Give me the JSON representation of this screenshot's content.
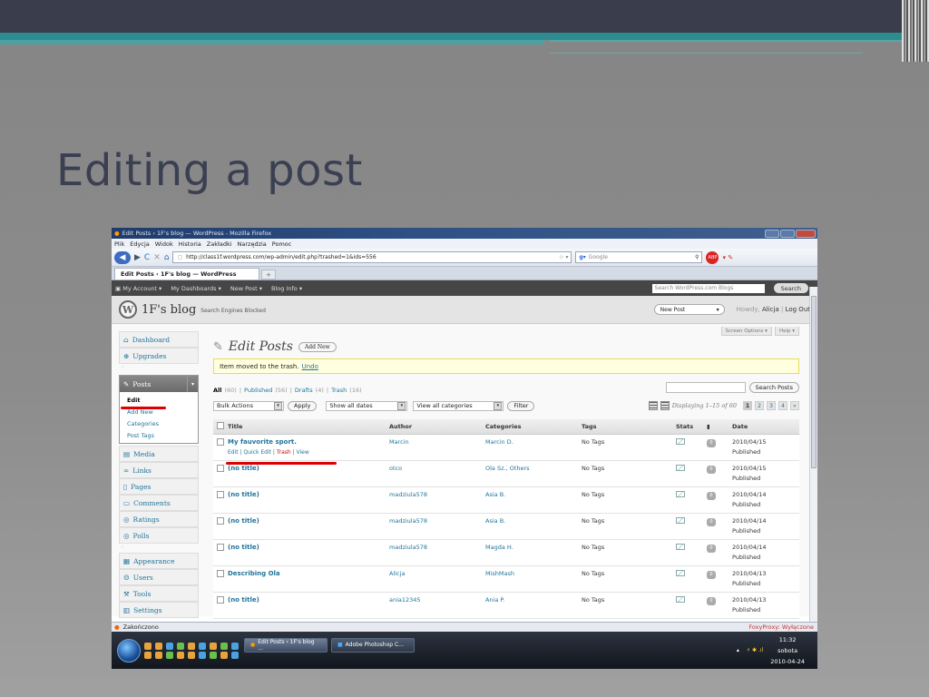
{
  "slide": {
    "title": "Editing a post"
  },
  "firefox": {
    "window_title": "Edit Posts ‹ 1F's blog — WordPress - Mozilla Firefox",
    "menu": [
      "Plik",
      "Edycja",
      "Widok",
      "Historia",
      "Zakładki",
      "Narzędzia",
      "Pomoc"
    ],
    "url": "http://class1f.wordpress.com/wp-admin/edit.php?trashed=1&ids=556",
    "search_placeholder": "Google",
    "tab_label": "Edit Posts ‹ 1F's blog — WordPress",
    "status": "Zakończono",
    "foxyproxy": "FoxyProxy: Wyłączone"
  },
  "adminbar": {
    "items": [
      "My Account ▾",
      "My Dashboards ▾",
      "New Post ▾",
      "Blog Info ▾"
    ],
    "search_placeholder": "Search WordPress.com Blogs",
    "search_button": "Search"
  },
  "header": {
    "blog_name": "1F's blog",
    "subtitle": "Search Engines Blocked",
    "new_post": "New Post",
    "howdy": "Howdy,",
    "user": "Alicja",
    "logout": "Log Out"
  },
  "sidebar": {
    "top": [
      "Dashboard",
      "Upgrades"
    ],
    "posts": "Posts",
    "posts_sub": [
      "Edit",
      "Add New",
      "Categories",
      "Post Tags"
    ],
    "mid": [
      "Media",
      "Links",
      "Pages",
      "Comments",
      "Ratings",
      "Polls"
    ],
    "bottom": [
      "Appearance",
      "Users",
      "Tools",
      "Settings"
    ]
  },
  "main": {
    "screen_options": "Screen Options ▾",
    "help": "Help ▾",
    "page_title": "Edit Posts",
    "add_new": "Add New",
    "notice": "Item moved to the trash.",
    "undo": "Undo",
    "filters": {
      "all": "All",
      "all_count": "(60)",
      "published": "Published",
      "published_count": "(56)",
      "drafts": "Drafts",
      "drafts_count": "(4)",
      "trash": "Trash",
      "trash_count": "(16)"
    },
    "search_button": "Search Posts",
    "bulk_actions": "Bulk Actions",
    "apply": "Apply",
    "dates": "Show all dates",
    "categories": "View all categories",
    "filter": "Filter",
    "displaying": "Displaying 1–15 of 60",
    "pages": [
      "1",
      "2",
      "3",
      "4",
      "»"
    ],
    "columns": [
      "Title",
      "Author",
      "Categories",
      "Tags",
      "Stats",
      "Date"
    ],
    "row_actions": {
      "edit": "Edit",
      "quick_edit": "Quick Edit",
      "trash": "Trash",
      "view": "View"
    },
    "rows": [
      {
        "title": "My fauvorite sport.",
        "author": "Marcin",
        "categories": "Marcin D.",
        "tags": "No Tags",
        "comments": "0",
        "date": "2010/04/15",
        "status": "Published"
      },
      {
        "title": "(no title)",
        "author": "otco",
        "categories": "Ola Sz., Others",
        "tags": "No Tags",
        "comments": "0",
        "date": "2010/04/15",
        "status": "Published"
      },
      {
        "title": "(no title)",
        "author": "madziula578",
        "categories": "Asia B.",
        "tags": "No Tags",
        "comments": "0",
        "date": "2010/04/14",
        "status": "Published"
      },
      {
        "title": "(no title)",
        "author": "madziula578",
        "categories": "Asia B.",
        "tags": "No Tags",
        "comments": "0",
        "date": "2010/04/14",
        "status": "Published"
      },
      {
        "title": "(no title)",
        "author": "madziula578",
        "categories": "Magda H.",
        "tags": "No Tags",
        "comments": "0",
        "date": "2010/04/14",
        "status": "Published"
      },
      {
        "title": "Describing Ola",
        "author": "Alicja",
        "categories": "MishMash",
        "tags": "No Tags",
        "comments": "0",
        "date": "2010/04/13",
        "status": "Published"
      },
      {
        "title": "(no title)",
        "author": "ania12345",
        "categories": "Ania P.",
        "tags": "No Tags",
        "comments": "0",
        "date": "2010/04/13",
        "status": "Published"
      }
    ]
  },
  "taskbar": {
    "tasks": [
      "Edit Posts ‹ 1F's blog ...",
      "Adobe Photoshop C..."
    ],
    "time": "11:32",
    "day": "sobota",
    "date": "2010-04-24"
  }
}
